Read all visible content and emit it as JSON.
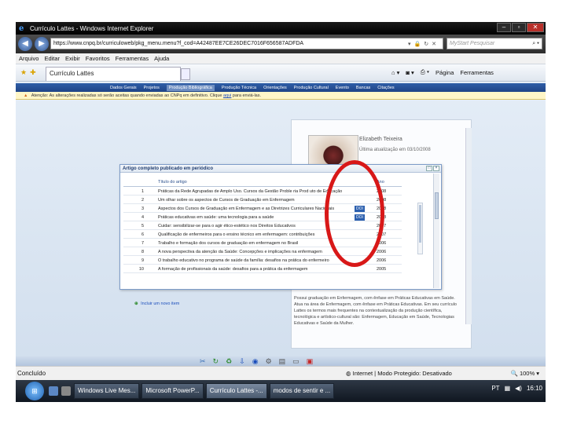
{
  "window": {
    "title": "Currículo Lattes - Windows Internet Explorer",
    "url": "https://www.cnpq.br/curriculoweb/pkg_menu.menu?f_cod=A42487EE7CE26DEC7016F656587ADFDA",
    "search_placeholder": "MyStart Pesquisar"
  },
  "menu": [
    "Arquivo",
    "Editar",
    "Exibir",
    "Favoritos",
    "Ferramentas",
    "Ajuda"
  ],
  "tab": {
    "label": "Currículo Lattes",
    "commands": [
      "Página",
      "Ferramentas"
    ]
  },
  "site_nav": [
    "Dados Gerais",
    "Projetos",
    "Produção Bibliográfica",
    "Produção Técnica",
    "Orientações",
    "Produção Cultural",
    "Evento",
    "Bancas",
    "Citações"
  ],
  "warning": {
    "text": "Atenção: As alterações realizadas só serão aceitas quando enviadas ao CNPq em definitivo. Clique",
    "link": "aqui",
    "tail": "para enviá-las."
  },
  "profile": {
    "name": "Elizabeth Teixeira",
    "date": "Última atualização em 03/10/2008",
    "bio": "Possui graduação em Enfermagem, com ênfase em Práticas Educativas em Saúde. Atua na área de Enfermagem, com ênfase em Práticas Educativas. Em seu currículo Lattes os termos mais frequentes na contextualização da produção científica, tecnológica e artístico-cultural são: Enfermagem, Educação em Saúde, Tecnologias Educativas e Saúde da Mulher."
  },
  "popup": {
    "title": "Artigo completo publicado em periódico",
    "col_title": "Título do artigo",
    "col_year": "Ano",
    "add_new": "Incluir um novo item",
    "rows": [
      {
        "n": "1",
        "title": "Práticas da Rede Agrupadas de Amplo Uso. Cursos da Gestão Proble ria Prod uto de Educação",
        "doi": "",
        "year": "2008"
      },
      {
        "n": "2",
        "title": "Um olhar sobre os aspectos de Cursos de Graduação em Enfermagem",
        "doi": "",
        "year": "2008"
      },
      {
        "n": "3",
        "title": "Aspectos dos Cursos de Graduação em Enfermagem e as Diretrizes Curriculares Nacionais",
        "doi": "DOI",
        "year": "2008"
      },
      {
        "n": "4",
        "title": "Práticas educativas em saúde: uma tecnologia para a saúde",
        "doi": "DOI",
        "year": "2008"
      },
      {
        "n": "5",
        "title": "Cuidar: sensibilizar-se para o agir ético-estético nos Direitos Educativos",
        "doi": "",
        "year": "2007"
      },
      {
        "n": "6",
        "title": "Qualificação de enfermeiros para o ensino técnico em enfermagem: contribuições",
        "doi": "",
        "year": "2007"
      },
      {
        "n": "7",
        "title": "Trabalho e formação dos cursos de graduação em enfermagem no Brasil",
        "doi": "",
        "year": "2006"
      },
      {
        "n": "8",
        "title": "A nova perspectiva da atenção da Saúde: Concepções e implicações na enfermagem",
        "doi": "",
        "year": "2006"
      },
      {
        "n": "9",
        "title": "O trabalho educativo no programa de saúde da família: desafios na prática do enfermeiro",
        "doi": "",
        "year": "2006"
      },
      {
        "n": "10",
        "title": "A formação de profissionais da saúde: desafios para a prática da enfermagem",
        "doi": "",
        "year": "2005"
      }
    ]
  },
  "status": {
    "left": "Concluído",
    "zone": "Internet | Modo Protegido: Desativado",
    "zoom": "100%"
  },
  "taskbar": {
    "buttons": [
      "Windows Live Mes...",
      "Microsoft PowerP...",
      "Currículo Lattes -...",
      "modos de sentir e ..."
    ],
    "lang": "PT",
    "time": "16:10"
  }
}
